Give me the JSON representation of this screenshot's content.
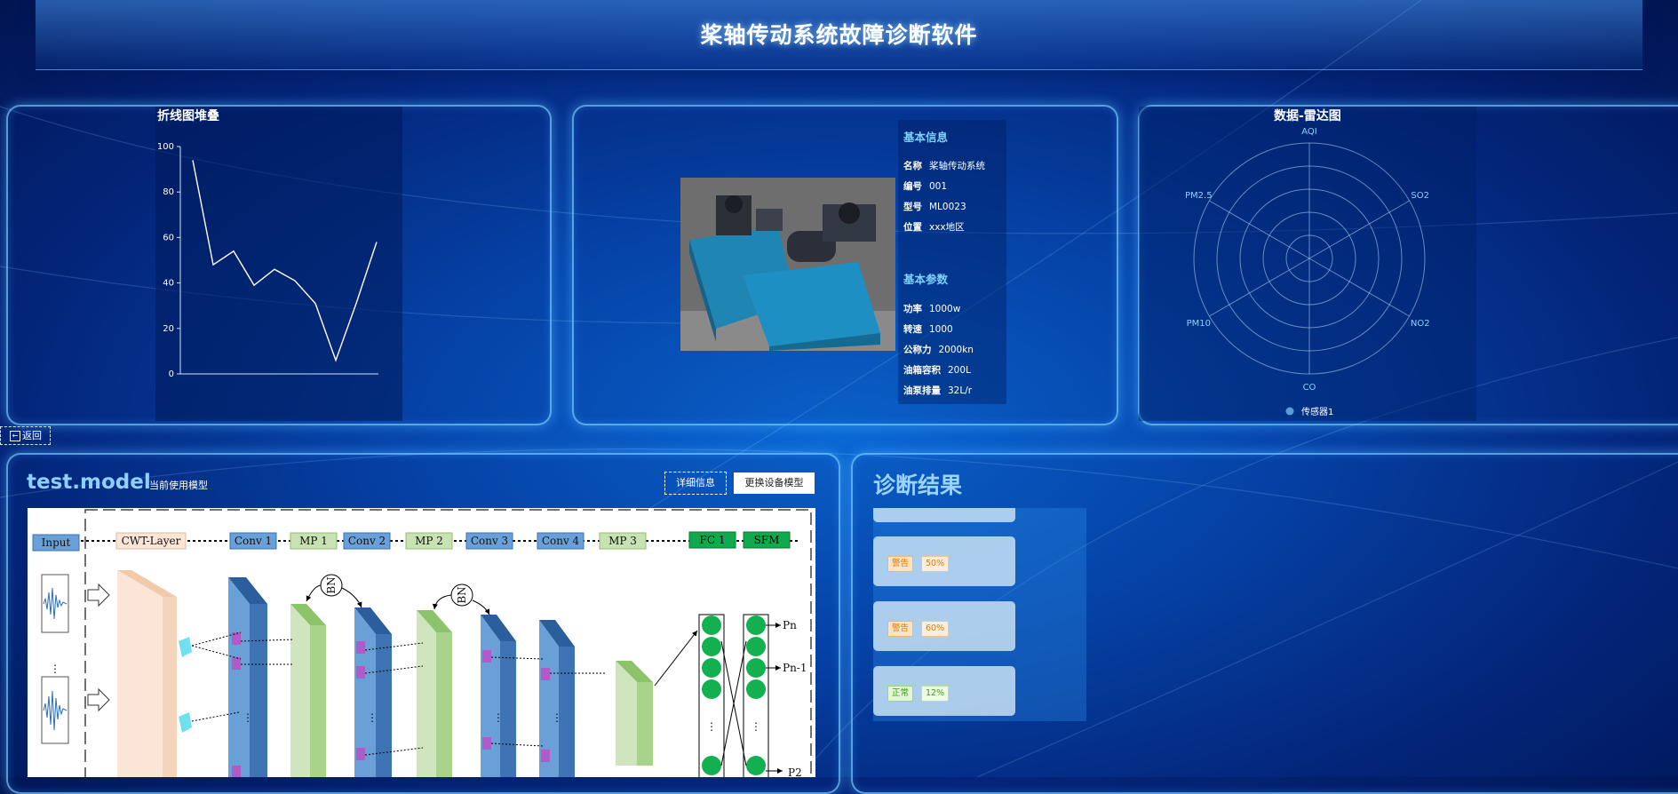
{
  "app": {
    "title": "桨轴传动系统故障诊断软件"
  },
  "line_panel": {
    "title": "折线图堆叠",
    "chart_data": {
      "type": "line",
      "title": "折线图堆叠",
      "x": [
        1,
        2,
        3,
        4,
        5,
        6,
        7,
        8,
        9,
        10
      ],
      "series": [
        {
          "values": [
            94,
            48,
            54,
            39,
            46,
            41,
            31,
            6,
            31,
            58
          ]
        }
      ],
      "ylim": [
        0,
        100
      ],
      "yticks": [
        0,
        20,
        40,
        60,
        80,
        100
      ],
      "grid": false,
      "line_color": "#ffffff"
    }
  },
  "device_panel": {
    "basic_title": "基本信息",
    "basic_rows": [
      {
        "k": "名称",
        "v": "桨轴传动系统"
      },
      {
        "k": "编号",
        "v": "001"
      },
      {
        "k": "型号",
        "v": "ML0023"
      },
      {
        "k": "位置",
        "v": "xxx地区"
      }
    ],
    "param_title": "基本参数",
    "param_rows": [
      {
        "k": "功率",
        "v": "1000w"
      },
      {
        "k": "转速",
        "v": "1000"
      },
      {
        "k": "公称力",
        "v": "2000kn"
      },
      {
        "k": "油箱容积",
        "v": "200L"
      },
      {
        "k": "油泵排量",
        "v": "32L/r"
      }
    ]
  },
  "radar_panel": {
    "title": "数据-雷达图",
    "chart_data": {
      "type": "radar",
      "indicators": [
        "AQI",
        "SO2",
        "NO2",
        "CO",
        "PM10",
        "PM2.5"
      ],
      "series": [
        {
          "name": "传感器1",
          "values": []
        }
      ],
      "legend": "bottom-center",
      "legend_color": "#5a9bd4"
    }
  },
  "back": {
    "label": "返回"
  },
  "model_panel": {
    "model_name": "test.model",
    "model_sub": "当前使用模型",
    "detail_btn": "详细信息",
    "switch_btn": "更换设备模型",
    "diagram": {
      "input": "Input",
      "cwt": "CWT-Layer",
      "conv1": "Conv 1",
      "mp1": "MP 1",
      "conv2": "Conv 2",
      "mp2": "MP 2",
      "conv3": "Conv 3",
      "conv4": "Conv 4",
      "mp3": "MP 3",
      "fc1": "FC 1",
      "sfm": "SFM",
      "bn": "BN",
      "pn": "Pn",
      "pn1": "Pn-1",
      "p2": "P2",
      "dots": "⋮"
    }
  },
  "results_panel": {
    "title": "诊断结果",
    "items": [
      {
        "status": "警告",
        "percent": "50%",
        "level": "warn"
      },
      {
        "status": "警告",
        "percent": "60%",
        "level": "warn"
      },
      {
        "status": "正常",
        "percent": "12%",
        "level": "ok"
      }
    ]
  }
}
